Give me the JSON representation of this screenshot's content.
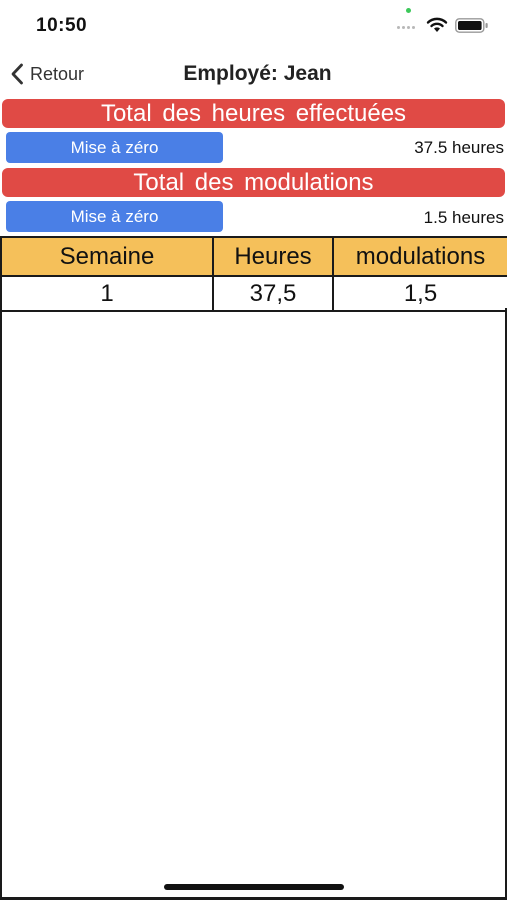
{
  "status_bar": {
    "time": "10:50"
  },
  "nav": {
    "back_label": "Retour",
    "title": "Employé: Jean"
  },
  "hours_section": {
    "banner": "Total  des heures  effectuées",
    "reset_label": "Mise à zéro",
    "value": "37.5 heures"
  },
  "modulations_section": {
    "banner": "Total  des modulations",
    "reset_label": "Mise à zéro",
    "value": "1.5 heures"
  },
  "table": {
    "headers": [
      "Semaine",
      "Heures",
      "modulations"
    ],
    "rows": [
      [
        "1",
        "37,5",
        "1,5"
      ]
    ]
  },
  "colors": {
    "banner_red": "#e04a45",
    "button_blue": "#4a7fe6",
    "header_orange": "#f5c05a"
  }
}
